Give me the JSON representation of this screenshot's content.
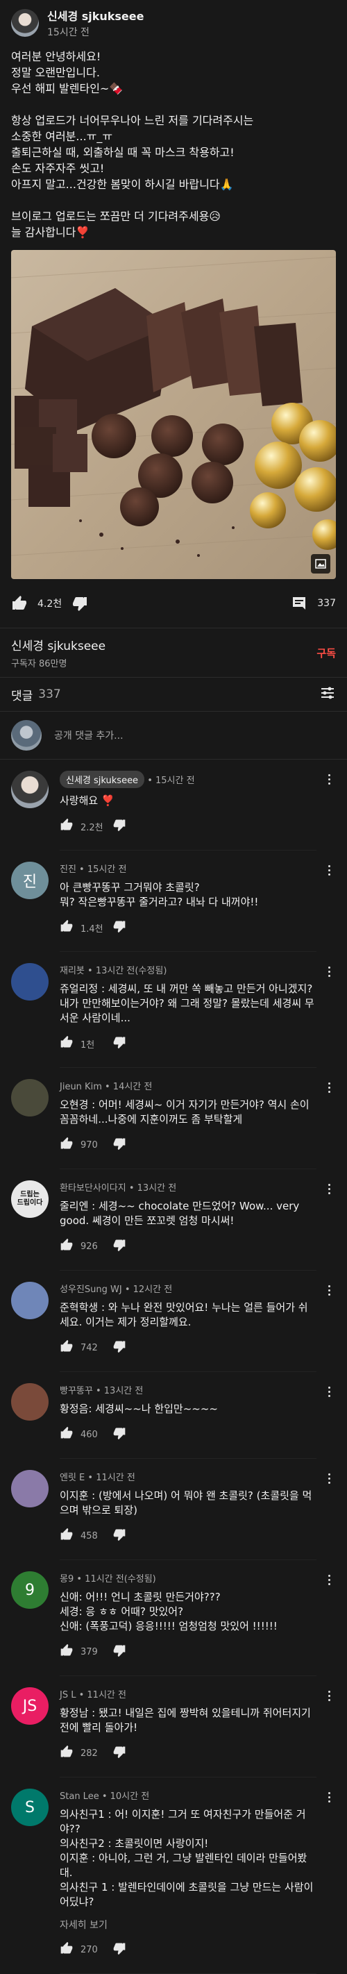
{
  "post": {
    "author": "신세경 sjkukseee",
    "time": "15시간 전",
    "body": "여러분 안녕하세요!\n정말 오랜만입니다.\n우선 해피 발렌타인~🍫\n\n항상 업로드가 너어무우나아 느린 저를 기다려주시는\n소중한 여러분...ㅠ_ㅠ\n출퇴근하실 때, 외출하실 때 꼭 마스크 착용하고!\n손도 자주자주 씻고!\n아프지 말고...건강한 봄맞이 하시길 바랍니다🙏\n\n브이로그 업로드는 쪼끔만 더 기다려주세용😥\n늘 감사합니다❣️",
    "likes": "4.2천",
    "comments_count": "337",
    "image_icon": "image-icon"
  },
  "channel": {
    "name": "신세경 sjkukseee",
    "subscribers": "구독자 86만명",
    "subscribe_label": "구독"
  },
  "comments_header": {
    "title": "댓글",
    "count": "337",
    "filter_icon": "sort-icon"
  },
  "add_comment": {
    "placeholder": "공개 댓글 추가..."
  },
  "comments": [
    {
      "author": "신세경 sjkukseee",
      "time": "15시간 전",
      "text": "사랑해요 ❣️",
      "likes": "2.2천",
      "owner": true,
      "avatar_text": "",
      "avatar_color": ""
    },
    {
      "author": "진진",
      "time": "15시간 전",
      "text": "아 큰빵꾸똥꾸 그거뭐야 초콜릿?\n뭐? 작은빵꾸똥꾸 줄거라고? 내놔 다 내꺼야!!",
      "likes": "1.4천",
      "owner": false,
      "avatar_text": "진",
      "avatar_color": "#6f8f9a"
    },
    {
      "author": "재리봇",
      "time": "13시간 전(수정됨)",
      "text": "쥬얼리정 : 세경씨, 또 내 꺼만 쏙 빼놓고 만든거 아니겠지? 내가 만만해보이는거야? 왜 그래 정말? 몰랐는데 세경씨 무서운 사람이네...",
      "likes": "1천",
      "owner": false,
      "avatar_text": "",
      "avatar_color": "#2f4f8f"
    },
    {
      "author": "Jieun Kim",
      "time": "14시간 전",
      "text": "오현경 : 어머! 세경씨~ 이거 자기가 만든거야? 역시 손이 꼼꼼하네...나중에 지훈이꺼도 좀 부탁할게",
      "likes": "970",
      "owner": false,
      "avatar_text": "",
      "avatar_color": "#4a4a3a"
    },
    {
      "author": "환타보단사이다지",
      "time": "13시간 전",
      "text": "줄리엔 : 세경~~ chocolate 만드었어? Wow... very good. 쎄경이 만든 쪼꼬렛 엄청 마시써!",
      "likes": "926",
      "owner": false,
      "avatar_text": "드립는\n드립이다",
      "avatar_color": "#e8e8e8"
    },
    {
      "author": "성우진Sung WJ",
      "time": "12시간 전",
      "text": "준혁학생 : 와 누나 완전 맛있어요! 누나는 얼른 들어가 쉬세요. 이거는 제가 정리할께요.",
      "likes": "742",
      "owner": false,
      "avatar_text": "",
      "avatar_color": "#6f86b8"
    },
    {
      "author": "빵꾸똥꾸",
      "time": "13시간 전",
      "text": "황정음: 세경씨~~나 한입만~~~~",
      "likes": "460",
      "owner": false,
      "avatar_text": "",
      "avatar_color": "#7a4a3a"
    },
    {
      "author": "엔릿 E",
      "time": "11시간 전",
      "text": "이지훈 : (방에서 나오며) 어 뭐야 왠 초콜릿? (초콜릿을 먹으며 밖으로 퇴장)",
      "likes": "458",
      "owner": false,
      "avatar_text": "",
      "avatar_color": "#8a7aa8"
    },
    {
      "author": "몽9",
      "time": "11시간 전(수정됨)",
      "text": "신애: 어!!! 언니 초콜릿 만든거야???\n세경: 응 ㅎㅎ 어때? 맛있어?\n신애: (폭풍고덕) 응응!!!!! 엄청엄청 맛있어 !!!!!!",
      "likes": "379",
      "owner": false,
      "avatar_text": "9",
      "avatar_color": "#2e7d32"
    },
    {
      "author": "JS L",
      "time": "11시간 전",
      "text": "황정남 : 됐고! 내일은 집에 짱박혀 있을테니까 쥐어터지기 전에 빨리 돌아가!",
      "likes": "282",
      "owner": false,
      "avatar_text": "JS",
      "avatar_color": "#e91e63"
    },
    {
      "author": "Stan Lee",
      "time": "10시간 전",
      "text": "의사친구1 : 어! 이지훈! 그거 또 여자친구가 만들어준 거야??\n의사친구2 : 초콜릿이면 사랑이지!\n이지훈 : 아니야, 그런 거, 그냥 발렌타인 데이라 만들어봤대.\n의사친구 1 : 발렌타인데이에 초콜릿을 그냥 만드는 사람이 어딨냐?",
      "likes": "270",
      "owner": false,
      "avatar_text": "S",
      "avatar_color": "#00796b",
      "more": "자세히 보기"
    }
  ]
}
